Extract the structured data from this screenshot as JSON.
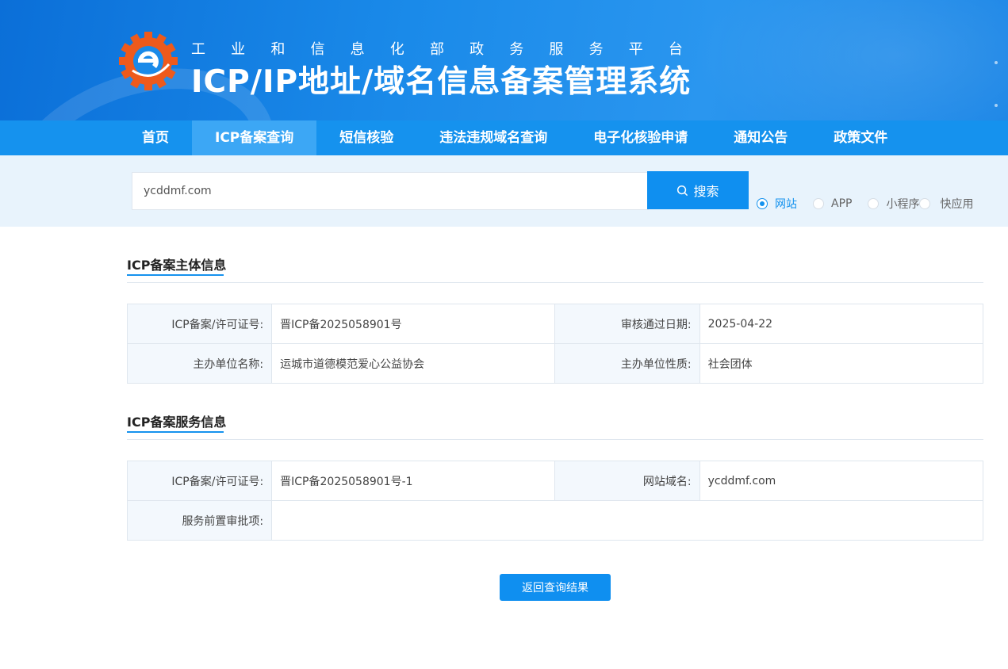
{
  "header": {
    "subtitle_chars": [
      "工",
      "业",
      "和",
      "信",
      "息",
      "化",
      "部",
      "政",
      "务",
      "服",
      "务",
      "平",
      "台"
    ],
    "title": "ICP/IP地址/域名信息备案管理系统"
  },
  "nav": {
    "items": [
      {
        "label": "首页",
        "active": false
      },
      {
        "label": "ICP备案查询",
        "active": true
      },
      {
        "label": "短信核验",
        "active": false
      },
      {
        "label": "违法违规域名查询",
        "active": false
      },
      {
        "label": "电子化核验申请",
        "active": false
      },
      {
        "label": "通知公告",
        "active": false
      },
      {
        "label": "政策文件",
        "active": false
      }
    ]
  },
  "search": {
    "value": "ycddmf.com",
    "button_label": "搜索",
    "options": [
      {
        "label": "网站",
        "checked": true
      },
      {
        "label": "APP",
        "checked": false
      },
      {
        "label": "小程序",
        "checked": false
      },
      {
        "label": "快应用",
        "checked": false
      }
    ]
  },
  "subject": {
    "title": "ICP备案主体信息",
    "rows": [
      [
        "ICP备案/许可证号:",
        "晋ICP备2025058901号",
        "审核通过日期:",
        "2025-04-22"
      ],
      [
        "主办单位名称:",
        "运城市道德模范爱心公益协会",
        "主办单位性质:",
        "社会团体"
      ]
    ]
  },
  "service": {
    "title": "ICP备案服务信息",
    "row1": [
      "ICP备案/许可证号:",
      "晋ICP备2025058901号-1",
      "网站域名:",
      "ycddmf.com"
    ],
    "row2_label": "服务前置审批项:",
    "row2_value": ""
  },
  "back_button_label": "返回查询结果",
  "colors": {
    "primary": "#1592ee",
    "nav_active": "#3ca7f5",
    "band": "#e8f3fc"
  }
}
